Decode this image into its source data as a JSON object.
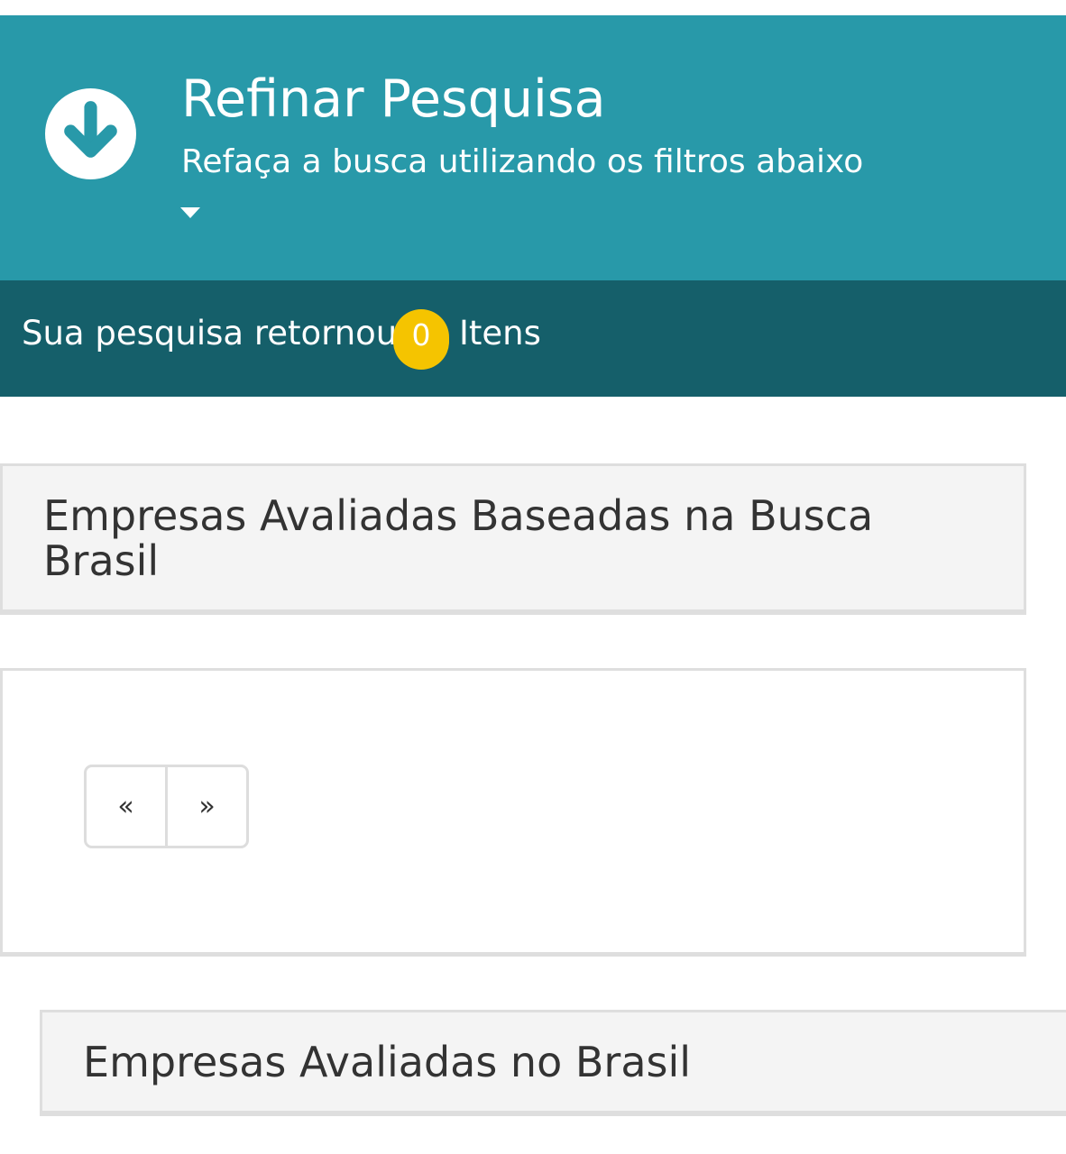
{
  "refine": {
    "title": "Refinar Pesquisa",
    "subtitle": "Refaça a busca utilizando os filtros abaixo",
    "icon": "circle-arrow-down-icon",
    "caret_icon": "caret-down-icon"
  },
  "results": {
    "prefix": "Sua pesquisa retornou",
    "count": "0",
    "suffix": "Itens"
  },
  "panels": {
    "search_based_title": "Empresas Avaliadas Baseadas na Busca Brasil",
    "brazil_title": "Empresas Avaliadas no Brasil"
  },
  "pagination": {
    "prev_label": "«",
    "next_label": "»"
  },
  "colors": {
    "banner": "#2899a9",
    "results_bar": "#155f6a",
    "count_badge": "#f5c400",
    "panel_bg": "#f4f4f4",
    "panel_border": "#dedede"
  }
}
